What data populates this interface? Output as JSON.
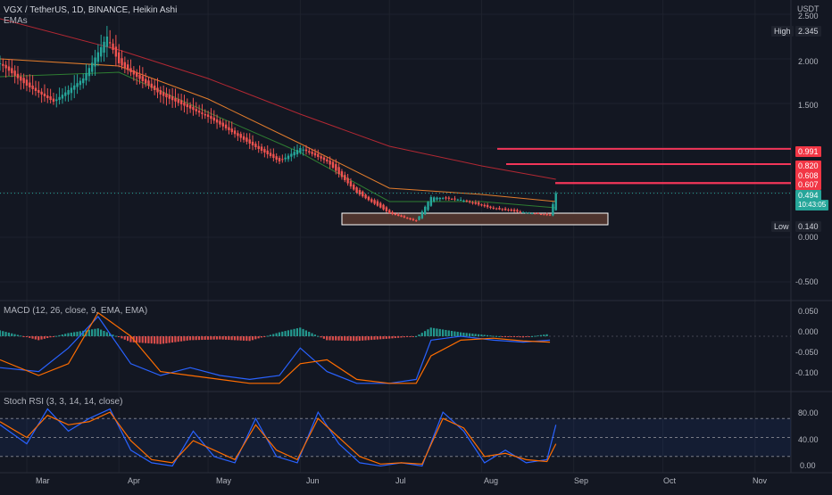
{
  "header": {
    "title": "VGX / TetherUS, 1D, BINANCE, Heikin Ashi",
    "indicator": "EMAs",
    "quote": "USDT"
  },
  "price_scale": {
    "ticks": [
      "2.500",
      "2.000",
      "1.500",
      "0.000",
      "-0.500"
    ],
    "high_label": "High",
    "high_value": "2.345",
    "low_label": "Low",
    "low_value": "0.140",
    "levels": [
      "0.991",
      "0.820",
      "0.608",
      "0.607"
    ],
    "last_price": "0.494",
    "countdown": "10:43:05"
  },
  "macd": {
    "title": "MACD (12, 26, close, 9, EMA, EMA)",
    "ticks": [
      "0.050",
      "0.000",
      "-0.050",
      "-0.100"
    ]
  },
  "rsi": {
    "title": "Stoch RSI (3, 3, 14, 14, close)",
    "ticks": [
      "80.00",
      "40.00",
      "0.00"
    ]
  },
  "time_axis": [
    "Mar",
    "Apr",
    "May",
    "Jun",
    "Jul",
    "Aug",
    "Sep",
    "Oct",
    "Nov"
  ],
  "colors": {
    "up": "#26a69a",
    "down": "#ef5350",
    "ema_slow": "#b22833",
    "ema_mid": "#e27c2c",
    "ema_fast": "#2e7d32",
    "level_line": "#f23659",
    "zone_fill": "#4e342e",
    "macd_line": "#2962ff",
    "signal_line": "#ff6d00"
  },
  "chart_data": [
    {
      "type": "candlestick",
      "title": "VGX / TetherUS, 1D, BINANCE, Heikin Ashi",
      "x_range": [
        "2023-02-20",
        "2023-11-05"
      ],
      "ylim": [
        -0.7,
        2.6
      ],
      "high": 2.345,
      "low": 0.14,
      "last": 0.494,
      "horizontal_levels": [
        0.991,
        0.82,
        0.608,
        0.607
      ],
      "support_zone": [
        0.14,
        0.27
      ],
      "ohlc_anchor_closes": [
        [
          "2023-02-20",
          1.95
        ],
        [
          "2023-03-01",
          1.7
        ],
        [
          "2023-03-10",
          1.52
        ],
        [
          "2023-03-20",
          1.78
        ],
        [
          "2023-03-28",
          2.25
        ],
        [
          "2023-04-01",
          1.95
        ],
        [
          "2023-04-15",
          1.6
        ],
        [
          "2023-05-01",
          1.35
        ],
        [
          "2023-05-15",
          1.05
        ],
        [
          "2023-05-25",
          0.85
        ],
        [
          "2023-06-01",
          1.0
        ],
        [
          "2023-06-10",
          0.85
        ],
        [
          "2023-06-20",
          0.5
        ],
        [
          "2023-07-01",
          0.27
        ],
        [
          "2023-07-10",
          0.18
        ],
        [
          "2023-07-15",
          0.45
        ],
        [
          "2023-07-25",
          0.42
        ],
        [
          "2023-08-05",
          0.32
        ],
        [
          "2023-08-15",
          0.28
        ],
        [
          "2023-08-24",
          0.25
        ],
        [
          "2023-08-26",
          0.494
        ]
      ],
      "series": [
        {
          "name": "EMAs",
          "color": "#b22833",
          "values": [
            [
              "2023-02-20",
              2.45
            ],
            [
              "2023-04-01",
              2.1
            ],
            [
              "2023-05-01",
              1.78
            ],
            [
              "2023-06-01",
              1.38
            ],
            [
              "2023-07-01",
              1.02
            ],
            [
              "2023-08-01",
              0.8
            ],
            [
              "2023-08-26",
              0.65
            ]
          ]
        },
        {
          "color": "#e27c2c",
          "values": [
            [
              "2023-02-20",
              2.0
            ],
            [
              "2023-04-01",
              1.92
            ],
            [
              "2023-05-01",
              1.55
            ],
            [
              "2023-06-01",
              1.05
            ],
            [
              "2023-07-01",
              0.55
            ],
            [
              "2023-08-01",
              0.48
            ],
            [
              "2023-08-26",
              0.4
            ]
          ]
        },
        {
          "color": "#2e7d32",
          "values": [
            [
              "2023-02-20",
              1.8
            ],
            [
              "2023-04-01",
              1.85
            ],
            [
              "2023-05-01",
              1.4
            ],
            [
              "2023-06-01",
              0.95
            ],
            [
              "2023-07-01",
              0.4
            ],
            [
              "2023-08-01",
              0.4
            ],
            [
              "2023-08-26",
              0.33
            ]
          ]
        }
      ]
    },
    {
      "type": "bar",
      "title": "MACD (12, 26, close, 9, EMA, EMA)",
      "ylim": [
        -0.125,
        0.075
      ],
      "x": [
        "2023-02-20",
        "2023-03-05",
        "2023-03-15",
        "2023-03-25",
        "2023-04-05",
        "2023-04-15",
        "2023-04-25",
        "2023-05-05",
        "2023-05-15",
        "2023-05-25",
        "2023-06-01",
        "2023-06-10",
        "2023-06-20",
        "2023-07-01",
        "2023-07-10",
        "2023-07-15",
        "2023-07-25",
        "2023-08-05",
        "2023-08-15",
        "2023-08-24"
      ],
      "series": [
        {
          "name": "histogram",
          "values": [
            0.015,
            -0.01,
            0.008,
            0.02,
            -0.015,
            -0.02,
            -0.01,
            -0.008,
            -0.012,
            0.01,
            0.022,
            -0.01,
            -0.012,
            -0.006,
            0.0,
            0.022,
            0.01,
            0.001,
            -0.003,
            0.006
          ]
        },
        {
          "name": "MACD",
          "values": [
            -0.08,
            -0.09,
            -0.03,
            0.05,
            -0.07,
            -0.1,
            -0.08,
            -0.1,
            -0.11,
            -0.1,
            -0.03,
            -0.09,
            -0.12,
            -0.12,
            -0.11,
            -0.01,
            0.0,
            -0.01,
            -0.015,
            -0.01
          ]
        },
        {
          "name": "Signal",
          "values": [
            -0.06,
            -0.1,
            -0.07,
            0.06,
            0.0,
            -0.09,
            -0.1,
            -0.11,
            -0.12,
            -0.12,
            -0.07,
            -0.06,
            -0.11,
            -0.12,
            -0.12,
            -0.05,
            -0.01,
            -0.005,
            -0.012,
            -0.015
          ]
        }
      ]
    },
    {
      "type": "line",
      "title": "Stoch RSI (3, 3, 14, 14, close)",
      "ylim": [
        0,
        100
      ],
      "bands": [
        20,
        50,
        80
      ],
      "x": [
        "2023-02-20",
        "2023-03-01",
        "2023-03-08",
        "2023-03-15",
        "2023-03-22",
        "2023-03-29",
        "2023-04-05",
        "2023-04-12",
        "2023-04-19",
        "2023-04-26",
        "2023-05-03",
        "2023-05-10",
        "2023-05-17",
        "2023-05-24",
        "2023-05-31",
        "2023-06-07",
        "2023-06-14",
        "2023-06-21",
        "2023-06-28",
        "2023-07-05",
        "2023-07-12",
        "2023-07-19",
        "2023-07-26",
        "2023-08-02",
        "2023-08-09",
        "2023-08-16",
        "2023-08-23",
        "2023-08-26"
      ],
      "series": [
        {
          "name": "K",
          "values": [
            70,
            40,
            95,
            60,
            80,
            95,
            30,
            10,
            5,
            60,
            20,
            10,
            80,
            20,
            10,
            90,
            40,
            10,
            5,
            10,
            5,
            90,
            60,
            10,
            30,
            10,
            15,
            70
          ]
        },
        {
          "name": "D",
          "values": [
            75,
            50,
            85,
            70,
            75,
            90,
            45,
            15,
            10,
            45,
            30,
            15,
            70,
            30,
            15,
            80,
            50,
            20,
            8,
            10,
            8,
            80,
            65,
            20,
            25,
            15,
            12,
            40
          ]
        }
      ]
    }
  ]
}
